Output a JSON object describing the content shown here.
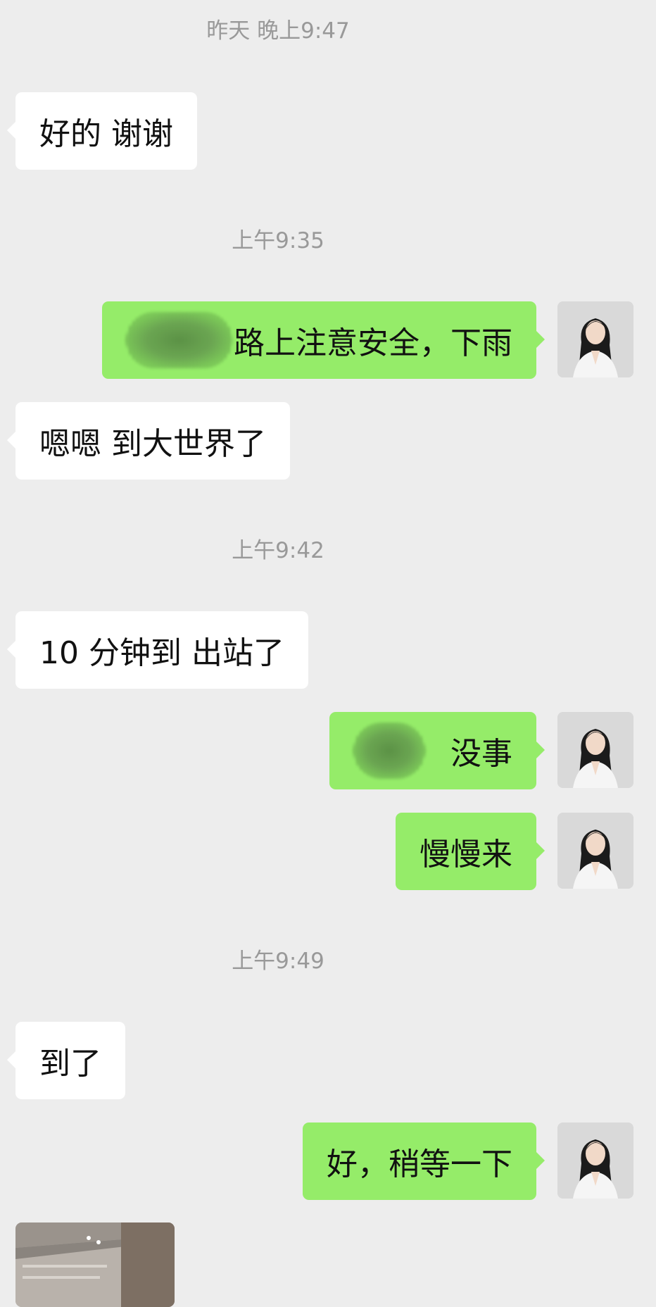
{
  "timestamps": {
    "t1": "昨天 晚上9:47",
    "t2": "上午9:35",
    "t3": "上午9:42",
    "t4": "上午9:49"
  },
  "messages": {
    "m1": "好的 谢谢",
    "m2": "路上注意安全，下雨",
    "m3": "嗯嗯 到大世界了",
    "m4": "10 分钟到 出站了",
    "m5": "没事",
    "m6": "慢慢来",
    "m7": "到了",
    "m8": "好，稍等一下"
  },
  "colors": {
    "background": "#ededed",
    "incoming_bubble": "#ffffff",
    "outgoing_bubble": "#95ec69",
    "timestamp_text": "#999999"
  },
  "icons": {
    "avatar": "user-avatar-portrait",
    "image_message": "photo-thumbnail"
  }
}
